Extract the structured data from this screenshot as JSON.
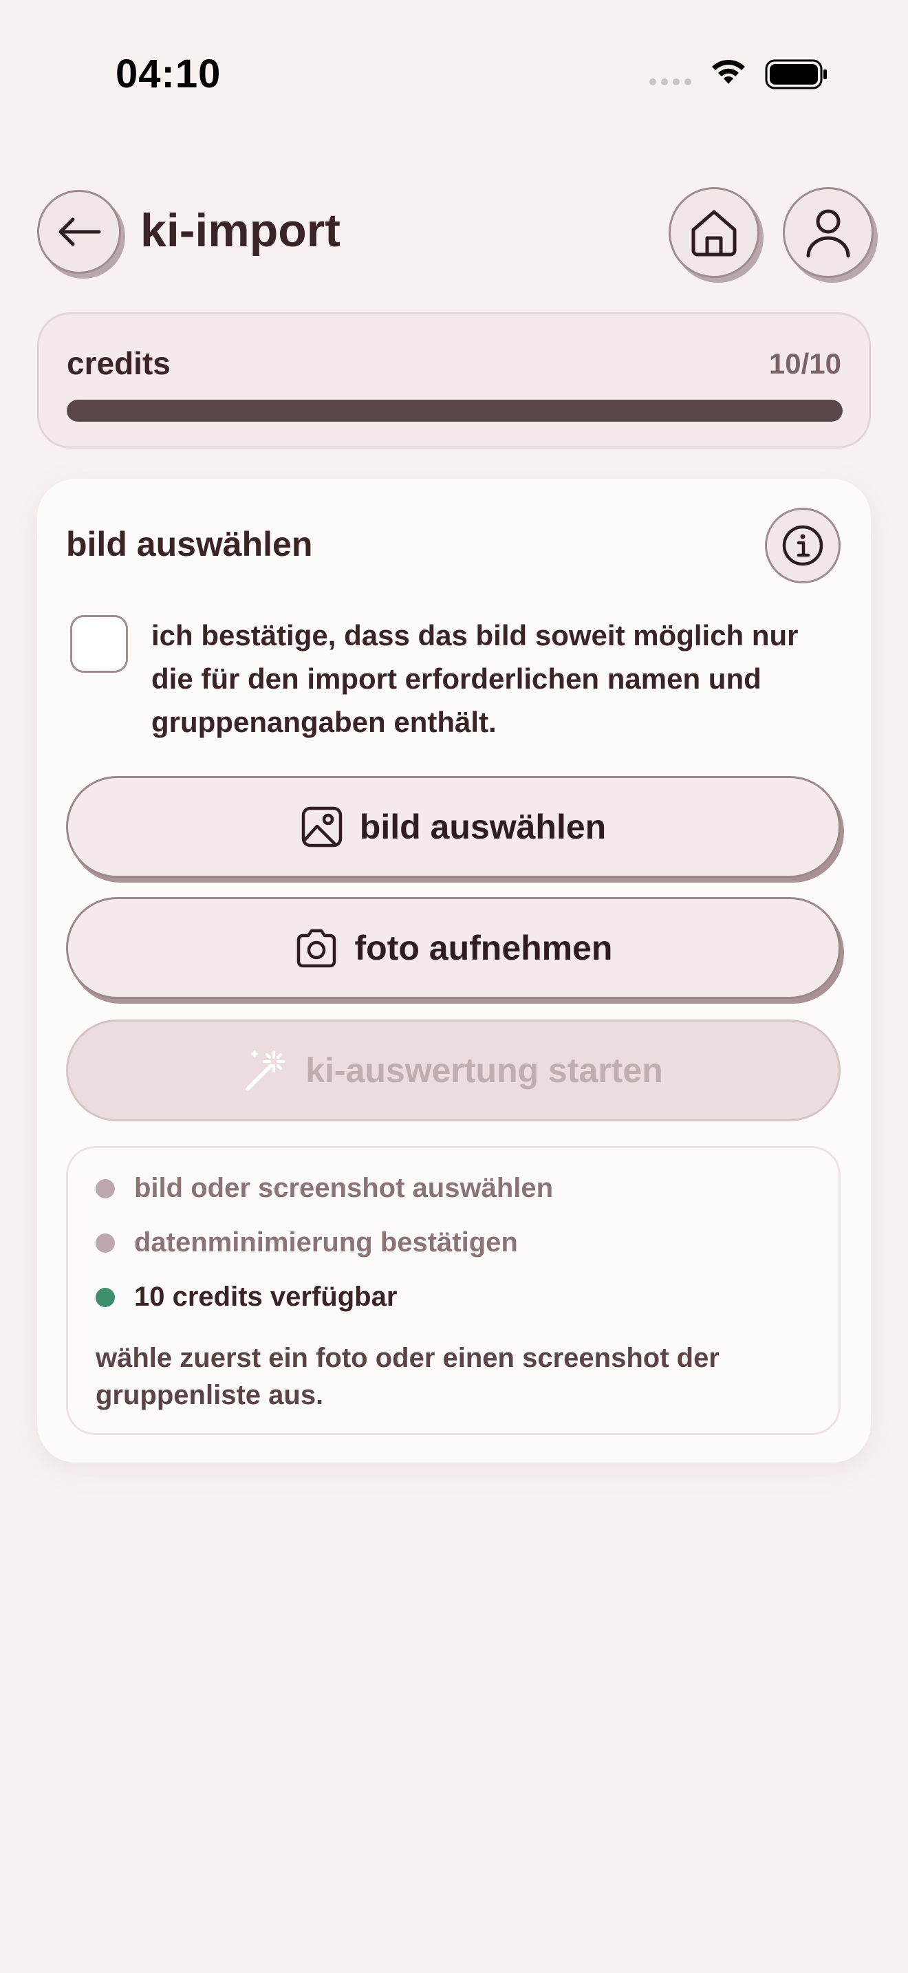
{
  "status_bar": {
    "time": "04:10"
  },
  "header": {
    "title": "ki-import"
  },
  "credits": {
    "label": "credits",
    "count": "10/10",
    "fraction": 1.0
  },
  "card": {
    "title": "bild auswählen",
    "consent_text": "ich bestätige, dass das bild soweit möglich nur die für den import erforderlichen namen und gruppenangaben enthält.",
    "buttons": {
      "pick_image": "bild auswählen",
      "take_photo": "foto aufnehmen",
      "start_ai": "ki-auswertung starten"
    },
    "checklist": [
      {
        "text": "bild oder screenshot auswählen",
        "done": false
      },
      {
        "text": "datenminimierung bestätigen",
        "done": false
      },
      {
        "text": "10 credits verfügbar",
        "done": true
      }
    ],
    "note": "wähle zuerst ein foto oder einen screenshot der gruppenliste aus."
  },
  "colors": {
    "accent_ok": "#3e8f6c",
    "pending": "#bca8aa",
    "text": "#3a2426"
  }
}
